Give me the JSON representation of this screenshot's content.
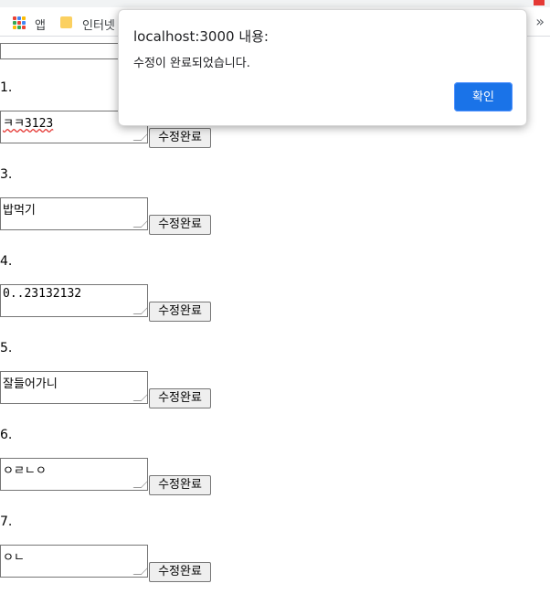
{
  "bookmarks": {
    "apps_label": "앱",
    "folder_label": "인터넷",
    "overflow": "»"
  },
  "items": [
    {
      "num": "1.",
      "text": "ㅋㅋ3123"
    },
    {
      "num": "3.",
      "text": "밥먹기"
    },
    {
      "num": "4.",
      "text": "0..23132132"
    },
    {
      "num": "5.",
      "text": "잘들어가니"
    },
    {
      "num": "6.",
      "text": "ㅇㄹㄴㅇ"
    },
    {
      "num": "7.",
      "text": "ㅇㄴ"
    }
  ],
  "button_label": "수정완료",
  "dialog": {
    "title": "localhost:3000 내용:",
    "message": "수정이 완료되었습니다.",
    "ok_label": "확인"
  },
  "colors": {
    "primary": "#1a73e8",
    "folder": "#fbd060"
  }
}
